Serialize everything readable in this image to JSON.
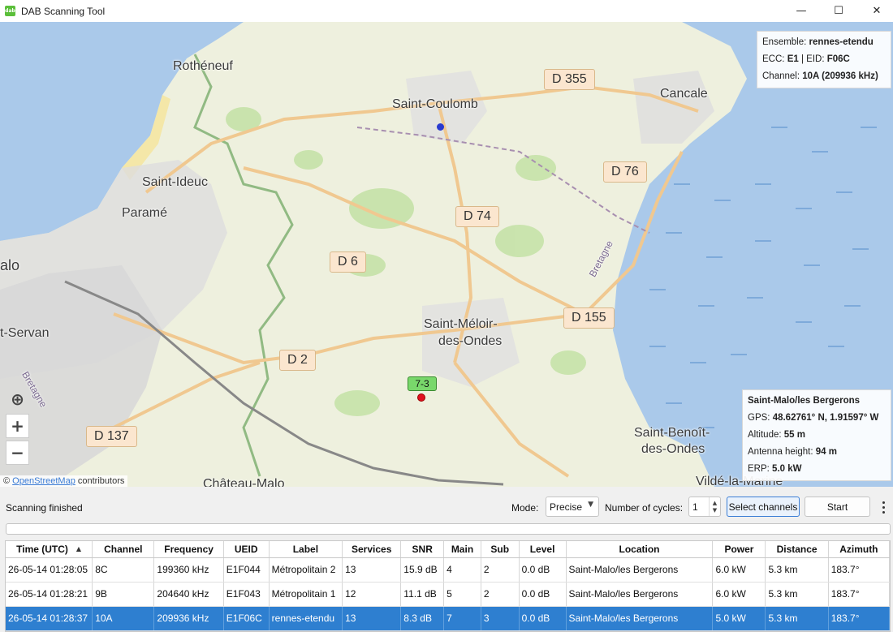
{
  "window": {
    "title": "DAB Scanning Tool",
    "icon_text": "dab",
    "controls": [
      "minimize-icon",
      "maximize-icon",
      "close-icon"
    ],
    "minimize_glyph": "—",
    "maximize_glyph": "☐",
    "close_glyph": "✕"
  },
  "map": {
    "places": [
      "Rothéneuf",
      "Saint-Coulomb",
      "Cancale",
      "Saint-Ideuc",
      "Paramé",
      "alo",
      "t-Servan",
      "Saint-Méloir-",
      "des-Ondes",
      "Saint-Benoît-",
      "des-Ondes",
      "Vildé-la-Marine",
      "Château-Malo"
    ],
    "roads": [
      "D 355",
      "D 76",
      "D 74",
      "D 6",
      "D 155",
      "D 2",
      "D 137"
    ],
    "water_labels": [
      "Bretagne",
      "Bretagne"
    ],
    "ensemble_box": {
      "ensemble_label": "Ensemble:",
      "ensemble_value": "rennes-etendu",
      "ecc_label": "ECC:",
      "ecc_value": "E1",
      "separator": " | ",
      "eid_label": "EID:",
      "eid_value": "F06C",
      "channel_label": "Channel:",
      "channel_value": "10A (209936 kHz)"
    },
    "transmitter_box": {
      "name": "Saint-Malo/les Bergerons",
      "gps_label": "GPS:",
      "gps_value": "48.62761° N, 1.91597° W",
      "altitude_label": "Altitude:",
      "altitude_value": "55 m",
      "antenna_label": "Antenna height:",
      "antenna_value": "94 m",
      "erp_label": "ERP:",
      "erp_value": "5.0 kW"
    },
    "marker_label": "7-3",
    "controls": {
      "locate": "⊕",
      "zoom_in": "+",
      "zoom_out": "−"
    },
    "attribution": {
      "prefix": "©",
      "link": "OpenStreetMap",
      "suffix": "contributors"
    }
  },
  "toolbar": {
    "status": "Scanning finished",
    "mode_label": "Mode:",
    "mode_value": "Precise",
    "cycles_label": "Number of cycles:",
    "cycles_value": "1",
    "select_channels_label": "Select channels",
    "start_label": "Start",
    "progress": 0
  },
  "table": {
    "columns": [
      "Time (UTC)",
      "Channel",
      "Frequency",
      "UEID",
      "Label",
      "Services",
      "SNR",
      "Main",
      "Sub",
      "Level",
      "Location",
      "Power",
      "Distance",
      "Azimuth"
    ],
    "sort_column": "Time (UTC)",
    "sort_direction": "ascending",
    "rows": [
      [
        "26-05-14 01:28:05",
        "8C",
        "199360 kHz",
        "E1F044",
        "Métropolitain 2",
        "13",
        "15.9 dB",
        "4",
        "2",
        "0.0 dB",
        "Saint-Malo/les Bergerons",
        "6.0 kW",
        "5.3 km",
        "183.7°"
      ],
      [
        "26-05-14 01:28:21",
        "9B",
        "204640 kHz",
        "E1F043",
        "Métropolitain 1",
        "12",
        "11.1 dB",
        "5",
        "2",
        "0.0 dB",
        "Saint-Malo/les Bergerons",
        "6.0 kW",
        "5.3 km",
        "183.7°"
      ],
      [
        "26-05-14 01:28:37",
        "10A",
        "209936 kHz",
        "E1F06C",
        "rennes-etendu",
        "13",
        "8.3 dB",
        "7",
        "3",
        "0.0 dB",
        "Saint-Malo/les Bergerons",
        "5.0 kW",
        "5.3 km",
        "183.7°"
      ]
    ],
    "selected_row": 2
  },
  "colors": {
    "selection": "#2e7fd0",
    "sea": "#aac9ea",
    "land": "#eef0de",
    "marker": "#79d86b"
  }
}
